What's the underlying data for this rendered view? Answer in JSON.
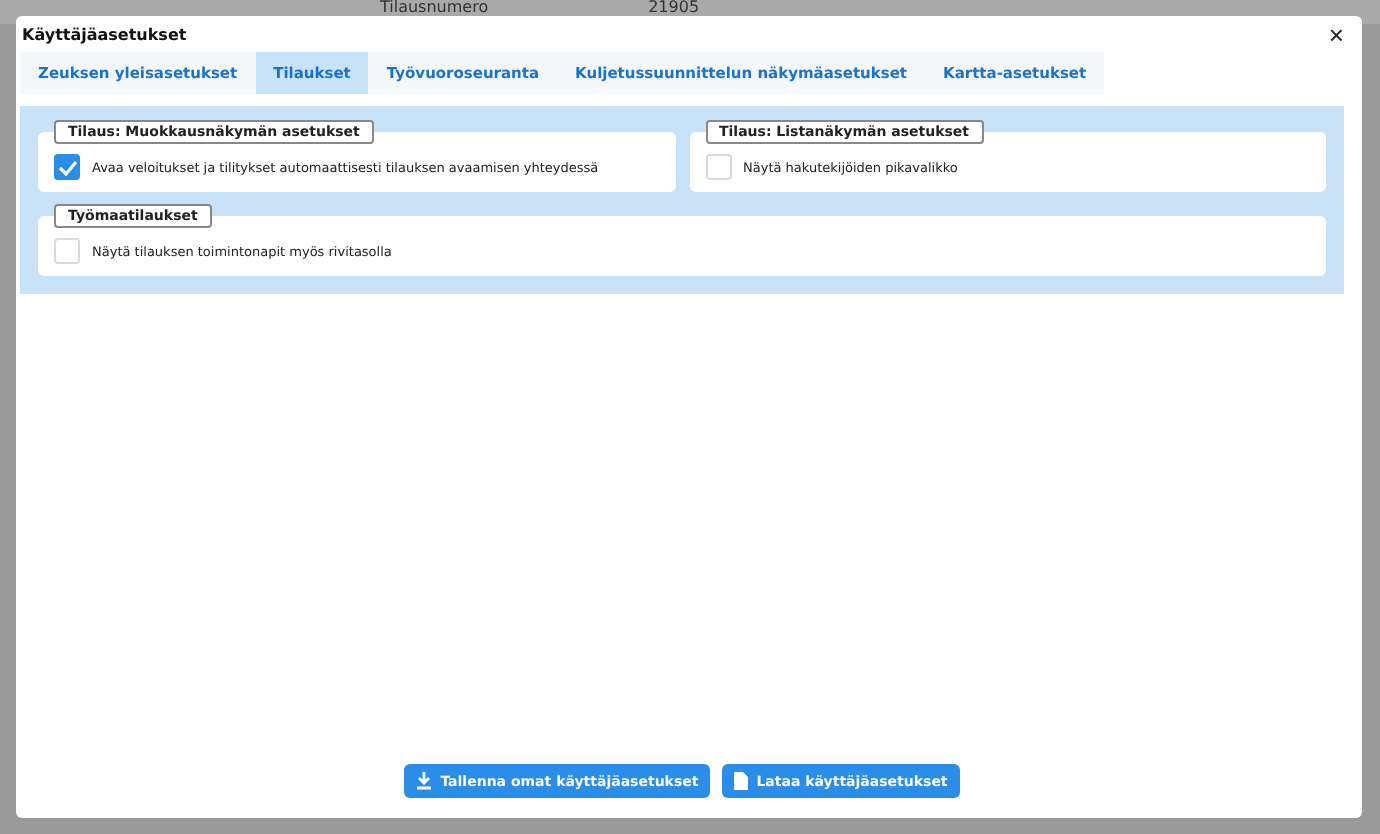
{
  "background": {
    "column_1": "Tilausnumero",
    "column_2": "21905"
  },
  "dialog": {
    "title": "Käyttäjäasetukset",
    "close": "×"
  },
  "tabs": [
    {
      "label": "Zeuksen yleisasetukset",
      "selected": false
    },
    {
      "label": "Tilaukset",
      "selected": true
    },
    {
      "label": "Työvuoroseuranta",
      "selected": false
    },
    {
      "label": "Kuljetussuunnittelun näkymäasetukset",
      "selected": false
    },
    {
      "label": "Kartta-asetukset",
      "selected": false
    }
  ],
  "groups": [
    {
      "title": "Tilaus: Muokkausnäkymän asetukset",
      "wide": false,
      "options": [
        {
          "label": "Avaa veloitukset ja tilitykset automaattisesti tilauksen avaamisen yhteydessä",
          "checked": true
        }
      ]
    },
    {
      "title": "Tilaus: Listanäkymän asetukset",
      "wide": false,
      "options": [
        {
          "label": "Näytä hakutekijöiden pikavalikko",
          "checked": false
        }
      ]
    },
    {
      "title": "Työmaatilaukset",
      "wide": true,
      "options": [
        {
          "label": "Näytä tilauksen toimintonapit myös rivitasolla",
          "checked": false
        }
      ]
    }
  ],
  "buttons": [
    {
      "label": "Tallenna omat käyttäjäasetukset",
      "kind": "download"
    },
    {
      "label": "Lataa käyttäjäasetukset",
      "kind": "file"
    }
  ]
}
